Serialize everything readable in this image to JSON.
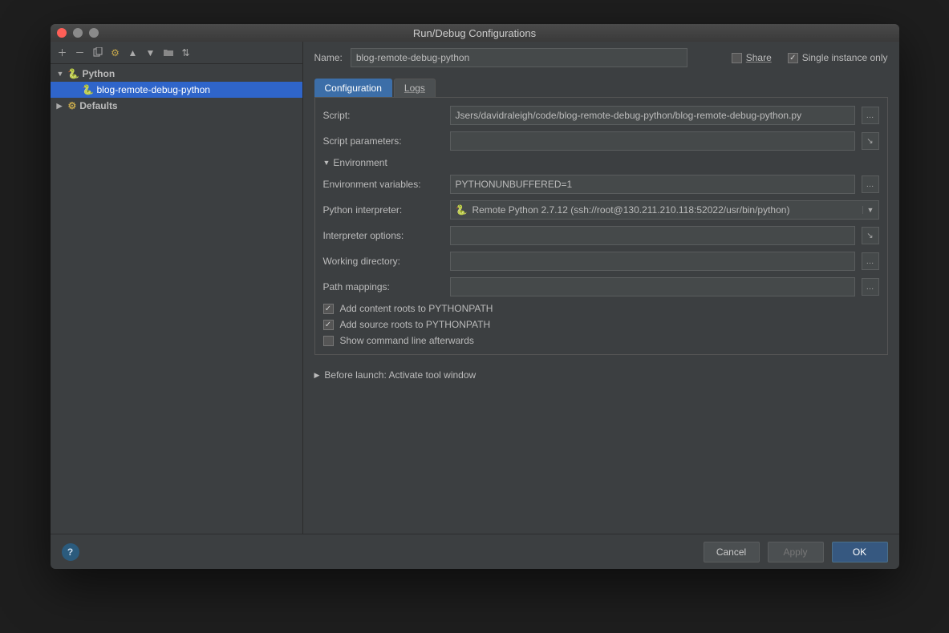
{
  "title": "Run/Debug Configurations",
  "toolbar_icons": [
    "add",
    "remove",
    "copy",
    "settings",
    "up",
    "down",
    "folder",
    "sort"
  ],
  "tree": {
    "python_label": "Python",
    "config_label": "blog-remote-debug-python",
    "defaults_label": "Defaults"
  },
  "name_label": "Name:",
  "name_value": "blog-remote-debug-python",
  "share_label": "Share",
  "single_instance_label": "Single instance only",
  "tabs": {
    "configuration": "Configuration",
    "logs": "Logs"
  },
  "fields": {
    "script_label": "Script:",
    "script_value": "Jsers/davidraleigh/code/blog-remote-debug-python/blog-remote-debug-python.py",
    "script_params_label": "Script parameters:",
    "script_params_value": "",
    "env_section": "Environment",
    "env_vars_label": "Environment variables:",
    "env_vars_value": "PYTHONUNBUFFERED=1",
    "interpreter_label": "Python interpreter:",
    "interpreter_value": "Remote Python 2.7.12 (ssh://root@130.211.210.118:52022/usr/bin/python)",
    "interp_opts_label": "Interpreter options:",
    "interp_opts_value": "",
    "workdir_label": "Working directory:",
    "workdir_value": "",
    "path_mappings_label": "Path mappings:",
    "path_mappings_value": "",
    "add_content_roots": "Add content roots to PYTHONPATH",
    "add_source_roots": "Add source roots to PYTHONPATH",
    "show_cmd": "Show command line afterwards"
  },
  "before_launch": "Before launch: Activate tool window",
  "buttons": {
    "cancel": "Cancel",
    "apply": "Apply",
    "ok": "OK"
  }
}
